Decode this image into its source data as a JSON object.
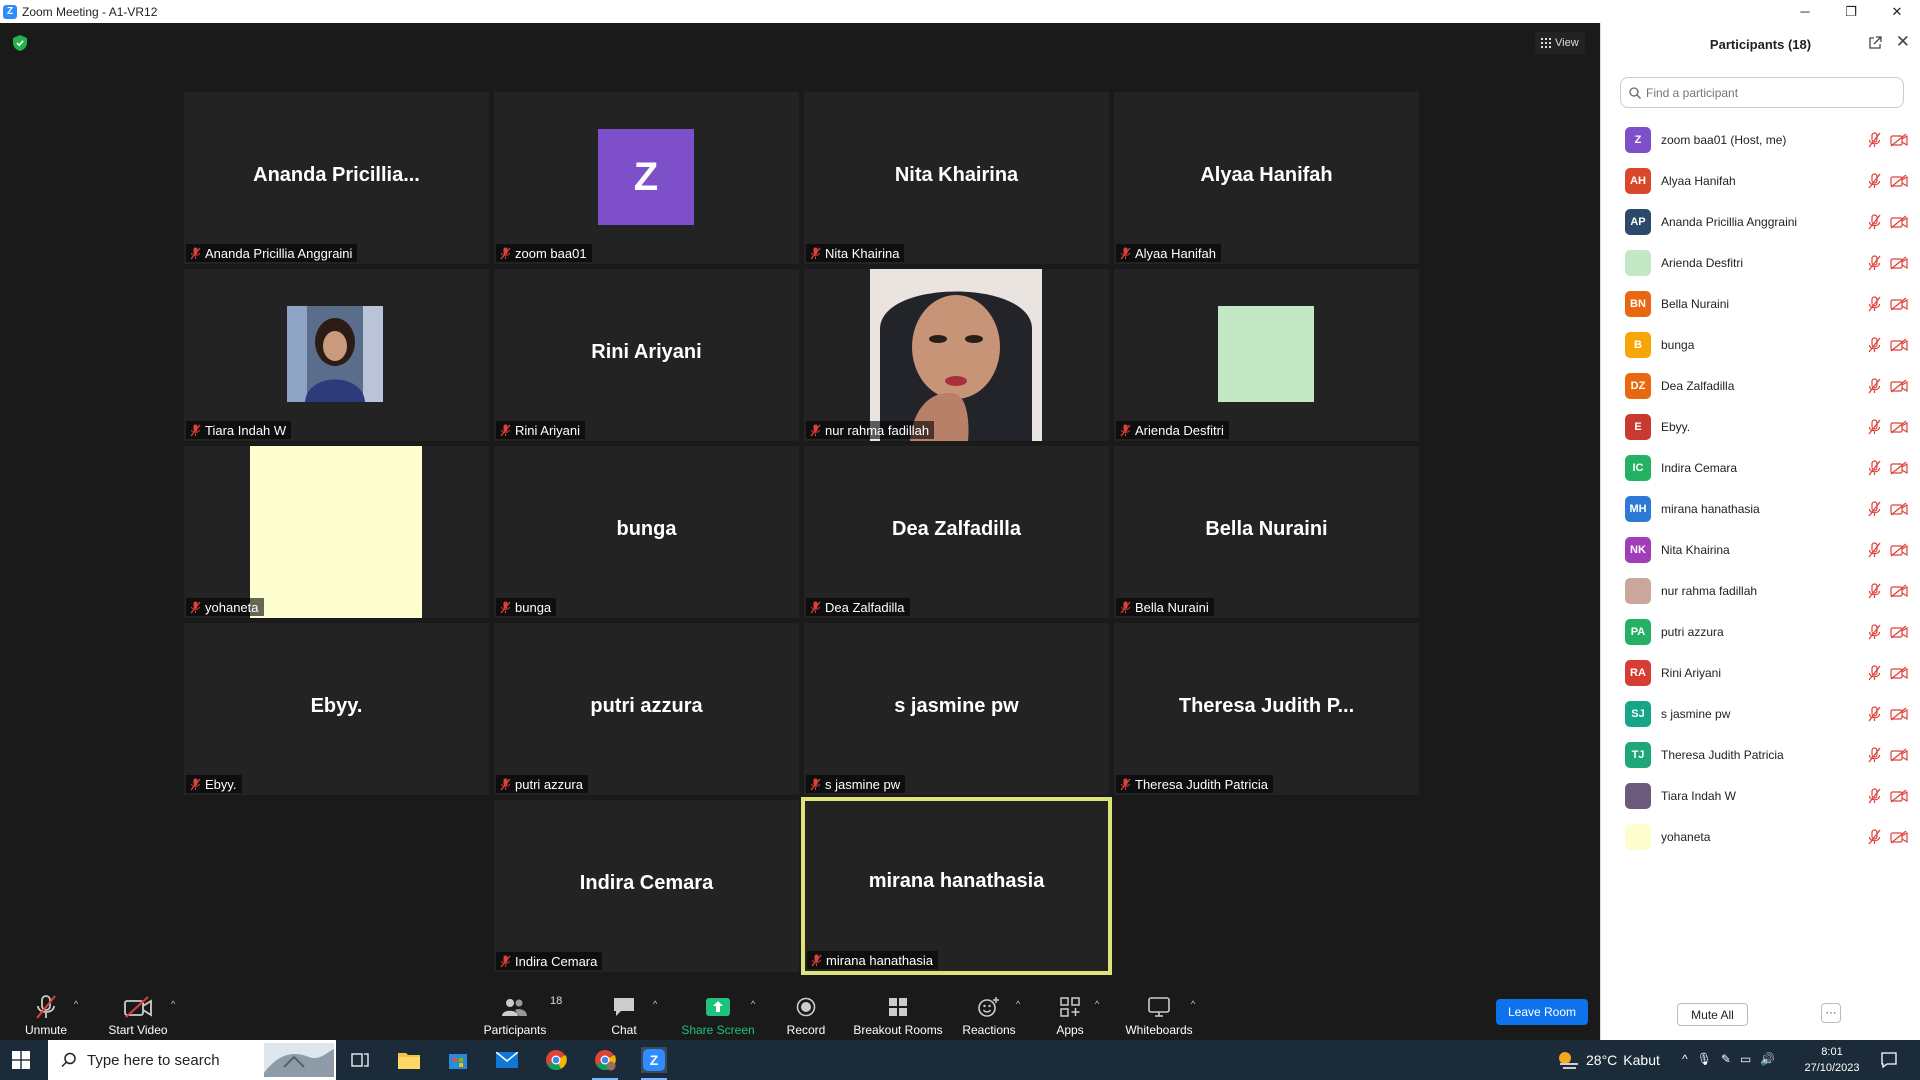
{
  "window": {
    "title": "Zoom Meeting - A1-VR12",
    "view_label": "View"
  },
  "tiles": [
    {
      "id": "ananda",
      "display": "Ananda  Pricillia...",
      "name": "Ananda Pricillia Anggraini"
    },
    {
      "id": "zoom",
      "display": "Z",
      "name": "zoom baa01"
    },
    {
      "id": "nita",
      "display": "Nita Khairina",
      "name": "Nita Khairina"
    },
    {
      "id": "alyaa",
      "display": "Alyaa Hanifah",
      "name": "Alyaa Hanifah"
    },
    {
      "id": "tiara",
      "display": "",
      "name": "Tiara Indah W"
    },
    {
      "id": "rini",
      "display": "Rini Ariyani",
      "name": "Rini Ariyani"
    },
    {
      "id": "nurrahma",
      "display": "",
      "name": "nur rahma fadillah"
    },
    {
      "id": "arienda",
      "display": "",
      "name": "Arienda Desfitri"
    },
    {
      "id": "yohaneta",
      "display": "",
      "name": "yohaneta"
    },
    {
      "id": "bunga",
      "display": "bunga",
      "name": "bunga"
    },
    {
      "id": "dea",
      "display": "Dea Zalfadilla",
      "name": "Dea Zalfadilla"
    },
    {
      "id": "bella",
      "display": "Bella Nuraini",
      "name": "Bella Nuraini"
    },
    {
      "id": "ebyy",
      "display": "Ebyy.",
      "name": "Ebyy."
    },
    {
      "id": "putri",
      "display": "putri azzura",
      "name": "putri azzura"
    },
    {
      "id": "jasmine",
      "display": "s jasmine pw",
      "name": "s jasmine pw"
    },
    {
      "id": "theresa",
      "display": "Theresa Judith P...",
      "name": "Theresa Judith Patricia"
    },
    {
      "id": "indira",
      "display": "Indira Cemara",
      "name": "Indira Cemara"
    },
    {
      "id": "mirana",
      "display": "mirana hanathasia",
      "name": "mirana hanathasia"
    }
  ],
  "toolbar": {
    "unmute": "Unmute",
    "start_video": "Start Video",
    "participants": "Participants",
    "participants_count": "18",
    "chat": "Chat",
    "share_screen": "Share Screen",
    "record": "Record",
    "breakout_rooms": "Breakout Rooms",
    "reactions": "Reactions",
    "apps": "Apps",
    "whiteboards": "Whiteboards",
    "leave": "Leave Room"
  },
  "panel": {
    "title": "Participants (18)",
    "search_placeholder": "Find a participant",
    "mute_all": "Mute All",
    "more": "···",
    "participants": [
      {
        "initials": "Z",
        "name": "zoom baa01 (Host, me)",
        "color": "#7d4fc8"
      },
      {
        "initials": "AH",
        "name": "Alyaa Hanifah",
        "color": "#d9482b"
      },
      {
        "initials": "AP",
        "name": "Ananda Pricillia Anggraini",
        "color": "#2b4a6b"
      },
      {
        "initials": "",
        "name": "Arienda Desfitri",
        "color": "#c2e8c6"
      },
      {
        "initials": "BN",
        "name": "Bella Nuraini",
        "color": "#e8670f"
      },
      {
        "initials": "B",
        "name": "bunga",
        "color": "#f6a609"
      },
      {
        "initials": "DZ",
        "name": "Dea Zalfadilla",
        "color": "#e8670f"
      },
      {
        "initials": "E",
        "name": "Ebyy.",
        "color": "#c93a2e"
      },
      {
        "initials": "IC",
        "name": "Indira Cemara",
        "color": "#24b163"
      },
      {
        "initials": "MH",
        "name": "mirana hanathasia",
        "color": "#2d7ad6"
      },
      {
        "initials": "NK",
        "name": "Nita Khairina",
        "color": "#a23db8"
      },
      {
        "initials": "",
        "name": "nur rahma fadillah",
        "color": "#caa79a"
      },
      {
        "initials": "PA",
        "name": "putri azzura",
        "color": "#24b163"
      },
      {
        "initials": "RA",
        "name": "Rini Ariyani",
        "color": "#d63e33"
      },
      {
        "initials": "SJ",
        "name": "s jasmine pw",
        "color": "#17a589"
      },
      {
        "initials": "TJ",
        "name": "Theresa Judith Patricia",
        "color": "#1fa67a"
      },
      {
        "initials": "",
        "name": "Tiara Indah W",
        "color": "#6b5a7a"
      },
      {
        "initials": "",
        "name": "yohaneta",
        "color": "#fdfecf"
      }
    ]
  },
  "taskbar": {
    "search_placeholder": "Type here to search",
    "weather_temp": "28°C",
    "weather_text": "Kabut",
    "time": "8:01",
    "date": "27/10/2023",
    "notification_count": "1"
  },
  "colors": {
    "accent_blue": "#0e72ed",
    "active_speaker": "#dfe47a",
    "share_green": "#1ec27a",
    "muted_red": "#e0403a"
  }
}
